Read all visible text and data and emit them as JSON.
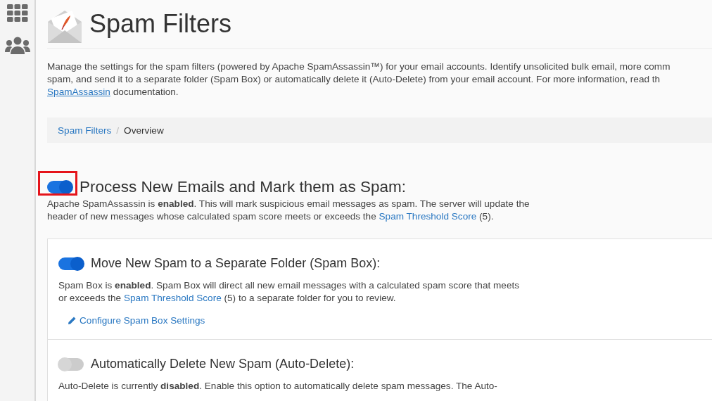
{
  "sidebar": {
    "items": [
      {
        "kind": "grid"
      },
      {
        "kind": "users"
      }
    ]
  },
  "page": {
    "title": "Spam Filters",
    "intro": {
      "lines": [
        "Manage the settings for the spam filters (powered by Apache SpamAssassin™) for your email accounts. Identify unsolicited bulk email, more comm",
        "spam, and send it to a separate folder (Spam Box) or automatically delete it (Auto-Delete) from your email account. For more information, read th"
      ],
      "link": "SpamAssassin",
      "tail": " documentation."
    }
  },
  "breadcrumb": {
    "separator": "/",
    "items": [
      {
        "label": "Spam Filters",
        "link": true
      },
      {
        "label": "Overview",
        "link": false
      }
    ]
  },
  "main_setting": {
    "title": "Process New Emails and Mark them as Spam:",
    "on": true,
    "highlighted": true,
    "text_before": "Apache SpamAssassin is **enabled**. This will mark suspicious email messages as spam. The server will update the header of new messages whose calculated spam score meets or exceeds the",
    "link": "Spam Threshold Score",
    "text_after": " (5)."
  },
  "settings": [
    {
      "title": "Move New Spam to a Separate Folder (Spam Box):",
      "on": true,
      "text_before": "Spam Box is **enabled**. Spam Box will direct all new email messages with a calculated spam score that meets or exceeds the",
      "link": "Spam Threshold Score",
      "text_after": " (5) to a separate folder for you to review.",
      "action": "Configure Spam Box Settings"
    },
    {
      "title": "Automatically Delete New Spam (Auto-Delete):",
      "on": false,
      "text_before": "Auto-Delete is currently **disabled**. Enable this option to automatically delete spam messages. The Auto-"
    }
  ]
}
